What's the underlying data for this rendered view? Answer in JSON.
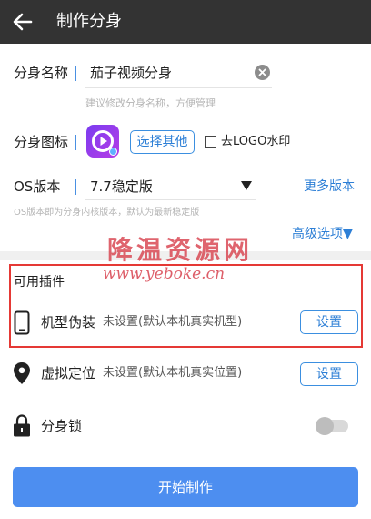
{
  "header": {
    "title": "制作分身"
  },
  "form": {
    "name_label": "分身名称",
    "name_value": "茄子视频分身",
    "name_hint": "建议修改分身名称，方便管理",
    "icon_label": "分身图标",
    "choose_other_label": "选择其他",
    "remove_logo_label": "去LOGO水印",
    "os_label": "OS版本",
    "os_value": "7.7稳定版",
    "more_versions_label": "更多版本",
    "os_hint": "OS版本即为分身内核版本，默认为最新稳定版",
    "advanced_label": "高级选项▼"
  },
  "plugins": {
    "section_title": "可用插件",
    "items": [
      {
        "name": "机型伪装",
        "desc": "未设置(默认本机真实机型)",
        "button": "设置",
        "icon": "phone-icon"
      },
      {
        "name": "虚拟定位",
        "desc": "未设置(默认本机真实位置)",
        "button": "设置",
        "icon": "location-pin-icon"
      },
      {
        "name": "分身锁",
        "icon": "lock-icon",
        "toggle_on": false
      }
    ]
  },
  "start_button": "开始制作",
  "watermark": {
    "text": "降温资源网",
    "url": "www.yeboke.cn"
  },
  "colors": {
    "topbar": "#333333",
    "accent": "#4d8ef0",
    "highlight_box": "#e53935"
  }
}
